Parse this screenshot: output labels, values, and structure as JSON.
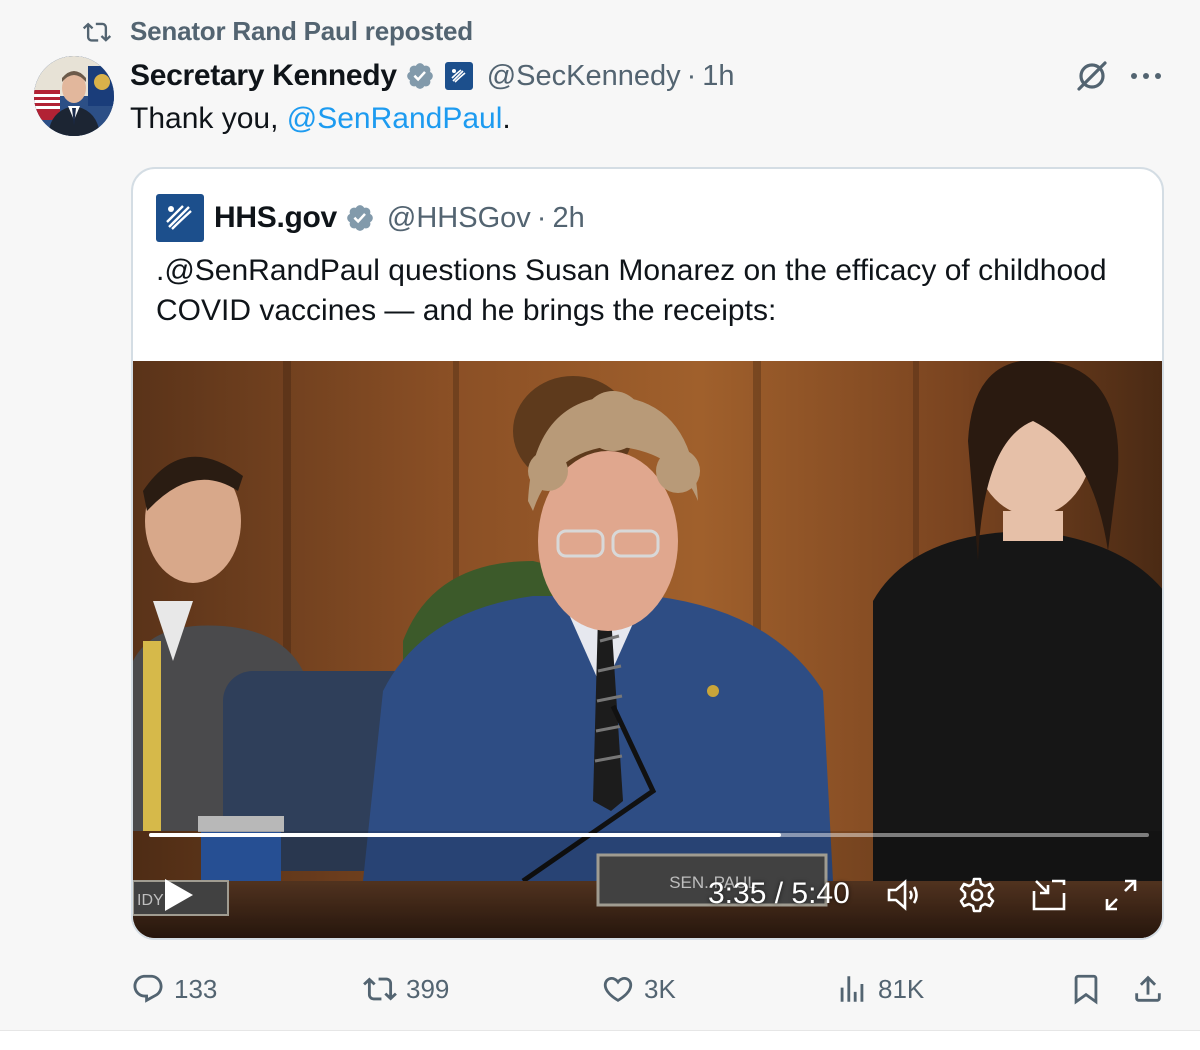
{
  "repost": {
    "label": "Senator Rand Paul reposted"
  },
  "tweet": {
    "author_name": "Secretary Kennedy",
    "handle": "@SecKennedy",
    "separator": "·",
    "time": "1h",
    "text_prefix": "Thank you, ",
    "mention": "@SenRandPaul",
    "text_suffix": "."
  },
  "quoted": {
    "author_name": "HHS.gov",
    "handle": "@HHSGov",
    "separator": "·",
    "time": "2h",
    "text": ".@SenRandPaul questions Susan Monarez on the efficacy of childhood COVID vaccines — and he brings the receipts:"
  },
  "video": {
    "nameplate": "SEN. PAUL",
    "nameplate_left": "IDY",
    "time_display": "3:35 / 5:40",
    "progress_fraction": 0.632
  },
  "actions": {
    "replies": "133",
    "reposts": "399",
    "likes": "3K",
    "views": "81K"
  },
  "colors": {
    "text": "#0f1419",
    "muted": "#536471",
    "link": "#1d9bf0",
    "verified": "#829aab"
  },
  "icons": [
    "repost-icon",
    "verified-icon",
    "hhs-badge-icon",
    "grok-icon",
    "more-icon",
    "play-icon",
    "volume-icon",
    "settings-icon",
    "pip-icon",
    "fullscreen-icon",
    "reply-icon",
    "like-icon",
    "views-icon",
    "bookmark-icon",
    "share-icon"
  ]
}
